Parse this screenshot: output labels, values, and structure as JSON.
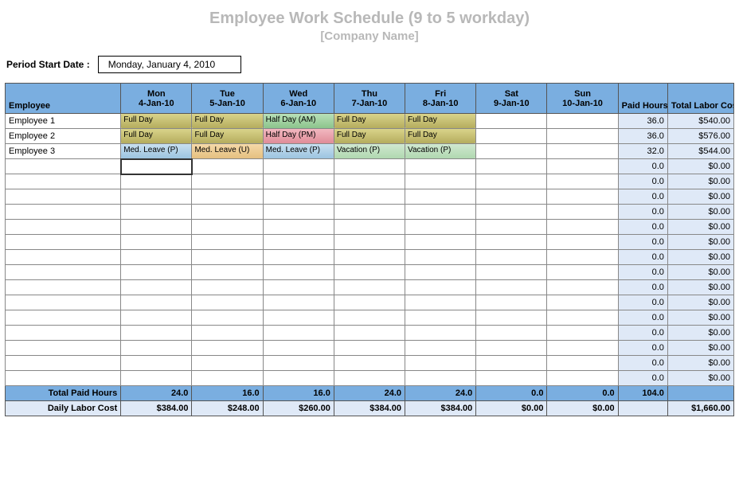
{
  "title": "Employee Work Schedule (9 to 5  workday)",
  "subtitle": "[Company Name]",
  "period_label": "Period Start Date :",
  "period_value": "Monday, January 4, 2010",
  "headers": {
    "employee": "Employee",
    "days": [
      {
        "name": "Mon",
        "date": "4-Jan-10"
      },
      {
        "name": "Tue",
        "date": "5-Jan-10"
      },
      {
        "name": "Wed",
        "date": "6-Jan-10"
      },
      {
        "name": "Thu",
        "date": "7-Jan-10"
      },
      {
        "name": "Fri",
        "date": "8-Jan-10"
      },
      {
        "name": "Sat",
        "date": "9-Jan-10"
      },
      {
        "name": "Sun",
        "date": "10-Jan-10"
      }
    ],
    "paid_hours": "Paid Hours",
    "labor_cost": "Total Labor Cost"
  },
  "rows": [
    {
      "name": "Employee 1",
      "sched": [
        {
          "t": "Full Day",
          "c": "fullday"
        },
        {
          "t": "Full Day",
          "c": "fullday"
        },
        {
          "t": "Half Day (AM)",
          "c": "halfam"
        },
        {
          "t": "Full Day",
          "c": "fullday"
        },
        {
          "t": "Full Day",
          "c": "fullday"
        },
        null,
        null
      ],
      "hours": "36.0",
      "cost": "$540.00"
    },
    {
      "name": "Employee 2",
      "sched": [
        {
          "t": "Full Day",
          "c": "fullday"
        },
        {
          "t": "Full Day",
          "c": "fullday"
        },
        {
          "t": "Half Day (PM)",
          "c": "halfpm"
        },
        {
          "t": "Full Day",
          "c": "fullday"
        },
        {
          "t": "Full Day",
          "c": "fullday"
        },
        null,
        null
      ],
      "hours": "36.0",
      "cost": "$576.00"
    },
    {
      "name": "Employee 3",
      "sched": [
        {
          "t": "Med. Leave (P)",
          "c": "medp"
        },
        {
          "t": "Med. Leave (U)",
          "c": "medu"
        },
        {
          "t": "Med. Leave (P)",
          "c": "medp"
        },
        {
          "t": "Vacation (P)",
          "c": "vac"
        },
        {
          "t": "Vacation (P)",
          "c": "vac"
        },
        null,
        null
      ],
      "hours": "32.0",
      "cost": "$544.00"
    },
    {
      "name": "",
      "sched": [
        null,
        null,
        null,
        null,
        null,
        null,
        null
      ],
      "hours": "0.0",
      "cost": "$0.00",
      "active": true
    },
    {
      "name": "",
      "sched": [
        null,
        null,
        null,
        null,
        null,
        null,
        null
      ],
      "hours": "0.0",
      "cost": "$0.00"
    },
    {
      "name": "",
      "sched": [
        null,
        null,
        null,
        null,
        null,
        null,
        null
      ],
      "hours": "0.0",
      "cost": "$0.00"
    },
    {
      "name": "",
      "sched": [
        null,
        null,
        null,
        null,
        null,
        null,
        null
      ],
      "hours": "0.0",
      "cost": "$0.00"
    },
    {
      "name": "",
      "sched": [
        null,
        null,
        null,
        null,
        null,
        null,
        null
      ],
      "hours": "0.0",
      "cost": "$0.00"
    },
    {
      "name": "",
      "sched": [
        null,
        null,
        null,
        null,
        null,
        null,
        null
      ],
      "hours": "0.0",
      "cost": "$0.00"
    },
    {
      "name": "",
      "sched": [
        null,
        null,
        null,
        null,
        null,
        null,
        null
      ],
      "hours": "0.0",
      "cost": "$0.00"
    },
    {
      "name": "",
      "sched": [
        null,
        null,
        null,
        null,
        null,
        null,
        null
      ],
      "hours": "0.0",
      "cost": "$0.00"
    },
    {
      "name": "",
      "sched": [
        null,
        null,
        null,
        null,
        null,
        null,
        null
      ],
      "hours": "0.0",
      "cost": "$0.00"
    },
    {
      "name": "",
      "sched": [
        null,
        null,
        null,
        null,
        null,
        null,
        null
      ],
      "hours": "0.0",
      "cost": "$0.00"
    },
    {
      "name": "",
      "sched": [
        null,
        null,
        null,
        null,
        null,
        null,
        null
      ],
      "hours": "0.0",
      "cost": "$0.00"
    },
    {
      "name": "",
      "sched": [
        null,
        null,
        null,
        null,
        null,
        null,
        null
      ],
      "hours": "0.0",
      "cost": "$0.00"
    },
    {
      "name": "",
      "sched": [
        null,
        null,
        null,
        null,
        null,
        null,
        null
      ],
      "hours": "0.0",
      "cost": "$0.00"
    },
    {
      "name": "",
      "sched": [
        null,
        null,
        null,
        null,
        null,
        null,
        null
      ],
      "hours": "0.0",
      "cost": "$0.00"
    },
    {
      "name": "",
      "sched": [
        null,
        null,
        null,
        null,
        null,
        null,
        null
      ],
      "hours": "0.0",
      "cost": "$0.00"
    }
  ],
  "totals": {
    "label": "Total Paid Hours",
    "days": [
      "24.0",
      "16.0",
      "16.0",
      "24.0",
      "24.0",
      "0.0",
      "0.0"
    ],
    "hours": "104.0",
    "cost": ""
  },
  "daily": {
    "label": "Daily Labor Cost",
    "days": [
      "$384.00",
      "$248.00",
      "$260.00",
      "$384.00",
      "$384.00",
      "$0.00",
      "$0.00"
    ],
    "hours": "",
    "cost": "$1,660.00"
  }
}
